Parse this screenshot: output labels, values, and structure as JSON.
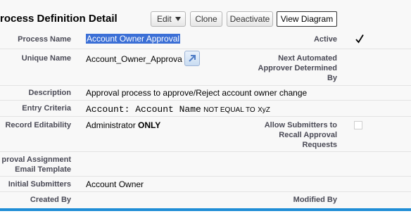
{
  "header": {
    "title": "rocess Definition Detail",
    "buttons": {
      "edit": "Edit",
      "clone": "Clone",
      "deactivate": "Deactivate",
      "view_diagram": "View Diagram"
    }
  },
  "fields": {
    "process_name": {
      "label": "Process Name",
      "value": "Account Owner Approval"
    },
    "active": {
      "label": "Active",
      "checked": true
    },
    "unique_name": {
      "label": "Unique Name",
      "value": "Account_Owner_Approva"
    },
    "next_automated_approver": {
      "label_line1": "Next Automated",
      "label_line2": "Approver Determined",
      "label_line3": "By",
      "value": ""
    },
    "description": {
      "label": "Description",
      "value": "Approval process to approve/Reject account owner change"
    },
    "entry_criteria": {
      "label": "Entry Criteria",
      "field": "Account: Account Name",
      "operator": "NOT EQUAL TO",
      "value": "XyZ"
    },
    "record_editability": {
      "label": "Record Editability",
      "value_prefix": "Administrator",
      "value_bold": "ONLY"
    },
    "allow_recall": {
      "label_line1": "Allow Submitters to",
      "label_line2": "Recall Approval",
      "label_line3": "Requests",
      "checked": false
    },
    "approval_template": {
      "label_line1": "proval Assignment",
      "label_line2": "Email Template",
      "value": ""
    },
    "initial_submitters": {
      "label": "Initial Submitters",
      "value": "Account Owner"
    },
    "created_by": {
      "label": "Created By",
      "value": ""
    },
    "modified_by": {
      "label": "Modified By",
      "value": ""
    }
  },
  "colors": {
    "accent_bar": "#1f8dd6",
    "selection": "#3b6fd6",
    "label_text": "#4a4a56"
  },
  "icons": {
    "active": "checkmark-icon",
    "unique_name_link": "external-link-icon"
  }
}
